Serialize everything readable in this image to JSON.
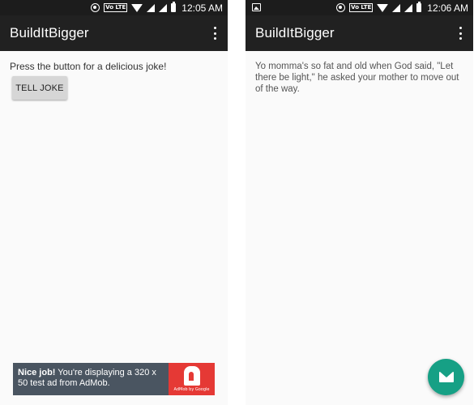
{
  "colors": {
    "status_bar": "#1c1c1c",
    "toolbar": "#212121",
    "background": "#fafafa",
    "fab": "#16a085",
    "ad_bg": "#4a5561",
    "ad_logo": "#e53935"
  },
  "screen1": {
    "status": {
      "volte": "Vo LTE",
      "time": "12:05 AM"
    },
    "toolbar": {
      "title": "BuildItBigger",
      "overflow_icon": "more-vert-icon"
    },
    "prompt": "Press the button for a delicious joke!",
    "tell_joke_label": "TELL JOKE",
    "ad": {
      "bold": "Nice job!",
      "text": " You're displaying a 320 x 50 test ad from AdMob.",
      "logo_caption": "AdMob by Google"
    }
  },
  "screen2": {
    "status": {
      "volte": "Vo LTE",
      "time": "12:06 AM"
    },
    "toolbar": {
      "title": "BuildItBigger",
      "overflow_icon": "more-vert-icon"
    },
    "joke": "Yo momma's so fat and old when God said, \"Let there be light,\" he asked your mother to move out of the way.",
    "fab_icon": "email-icon"
  }
}
